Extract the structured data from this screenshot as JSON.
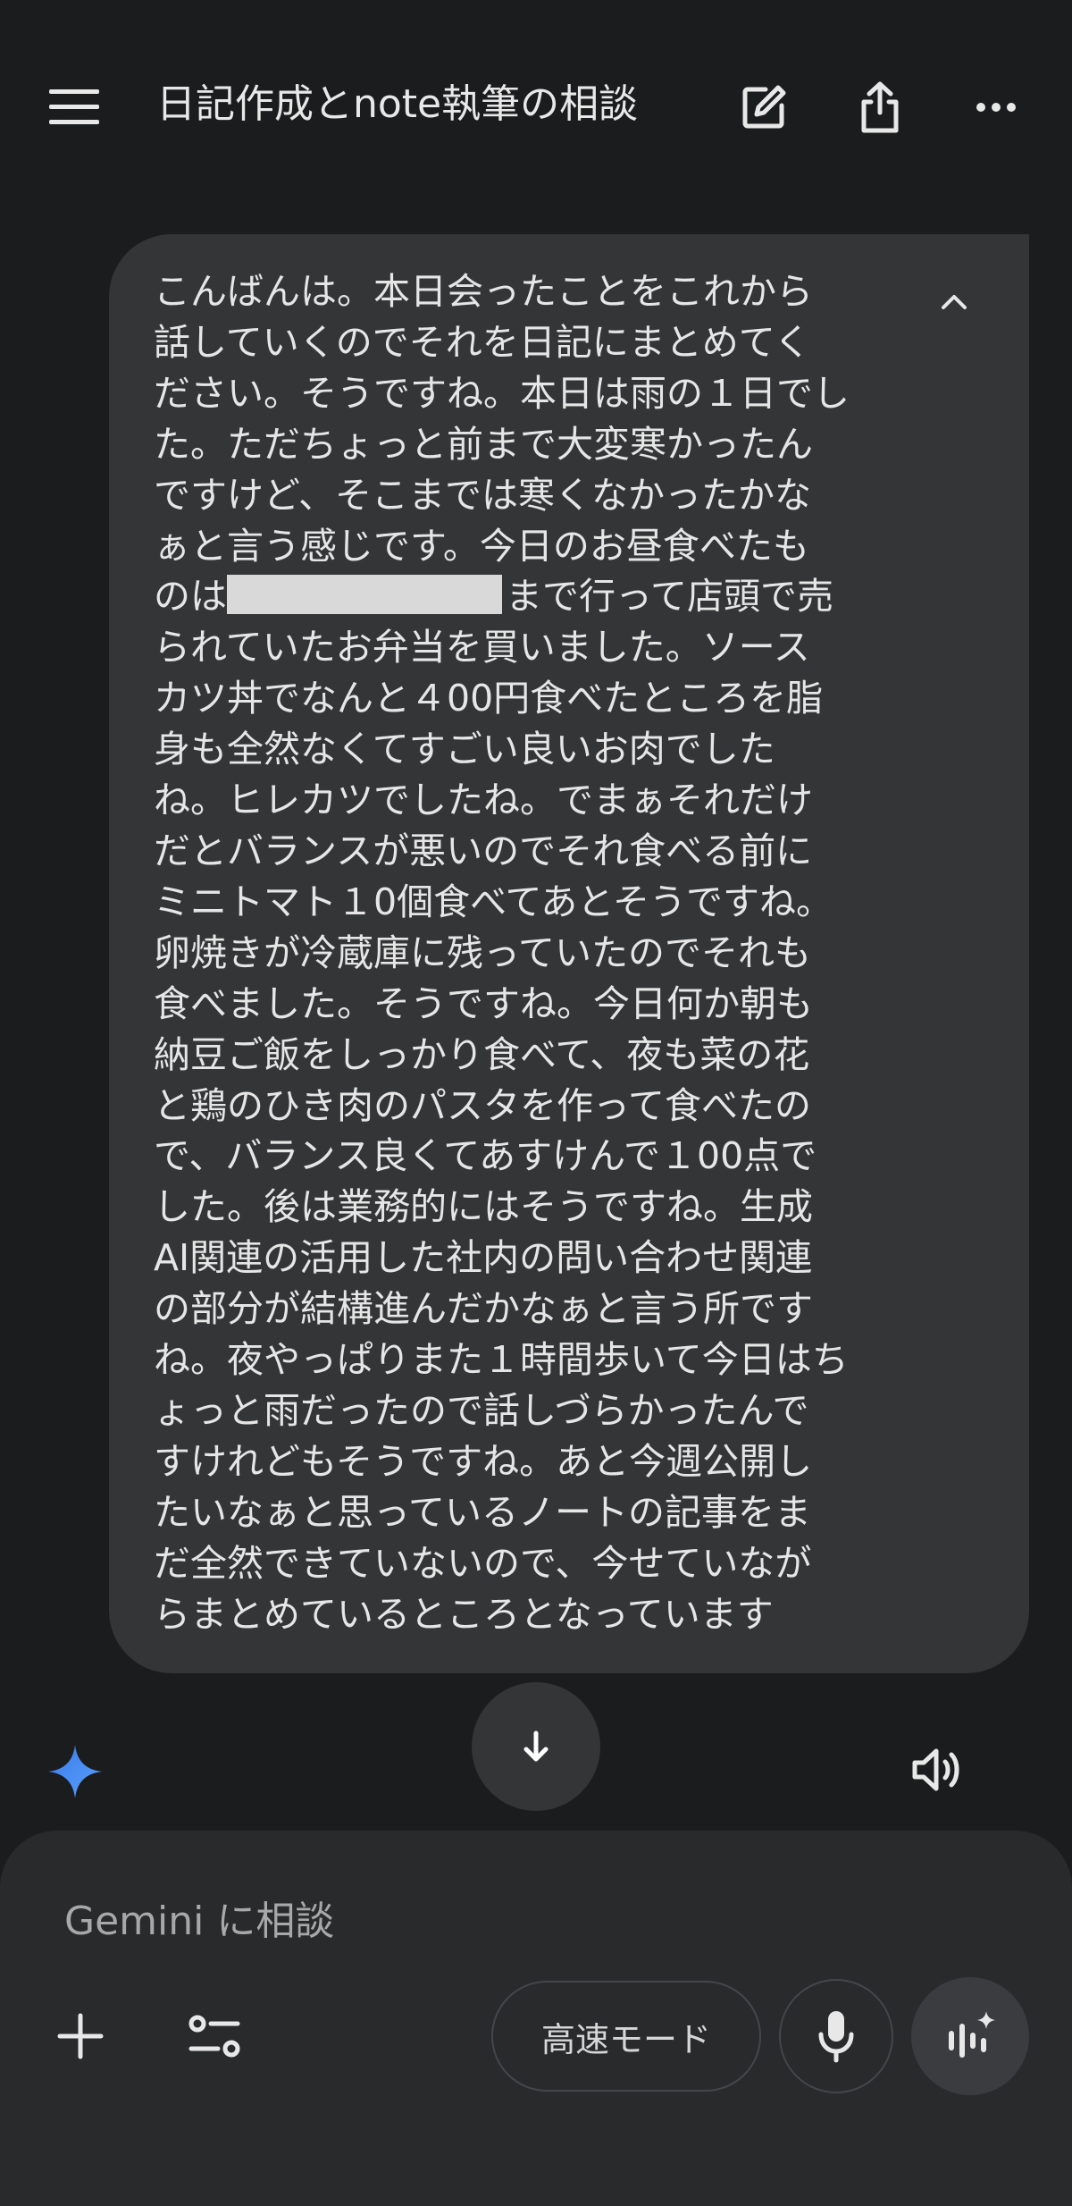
{
  "header": {
    "title": "日記作成とnote執筆の相談",
    "menu_icon": "hamburger-menu-icon",
    "new_chat_icon": "edit-icon",
    "share_icon": "share-icon",
    "more_icon": "more-horizontal-icon"
  },
  "message": {
    "lines": [
      "こんばんは。本日会ったことをこれから",
      "話していくのでそれを日記にまとめてく",
      "ださい。そうですね。本日は雨の１日でし",
      "た。ただちょっと前まで大変寒かったん",
      "ですけど、そこまでは寒くなかったかな",
      "ぁと言う感じです。今日のお昼食べたも",
      "のは",
      "まで行って店頭で売",
      "られていたお弁当を買いました。ソース",
      "カツ丼でなんと４00円食べたところを脂",
      "身も全然なくてすごい良いお肉でした",
      "ね。ヒレカツでしたね。でまぁそれだけ",
      "だとバランスが悪いのでそれ食べる前に",
      "ミニトマト１0個食べてあとそうですね。",
      "卵焼きが冷蔵庫に残っていたのでそれも",
      "食べました。そうですね。今日何か朝も",
      "納豆ご飯をしっかり食べて、夜も菜の花",
      "と鶏のひき肉のパスタを作って食べたの",
      "で、バランス良くてあすけんで１00点で",
      "した。後は業務的にはそうですね。生成",
      "AI関連の活用した社内の問い合わせ関連",
      "の部分が結構進んだかなぁと言う所です",
      "ね。夜やっぱりまた１時間歩いて今日はち",
      "ょっと雨だったので話しづらかったんで",
      "すけれどもそうですね。あと今週公開し",
      "たいなぁと思っているノートの記事をま",
      "だ全然できていないので、今せていなが",
      "らまとめているところとなっています"
    ],
    "collapse_icon": "chevron-up-icon"
  },
  "scroll_down_icon": "arrow-down-icon",
  "gemini_icon": "gemini-sparkle-icon",
  "speaker_icon": "speaker-icon",
  "composer": {
    "placeholder": "Gemini に相談",
    "add_icon": "plus-icon",
    "tools_icon": "tools-icon",
    "mode_label": "高速モード",
    "mic_icon": "microphone-icon",
    "live_icon": "live-voice-icon"
  },
  "colors": {
    "background": "#1b1c1d",
    "bubble": "#333537",
    "composer": "#282a2c",
    "gemini_blue": "#4a8ef5",
    "redaction": "#d9d9d9"
  }
}
